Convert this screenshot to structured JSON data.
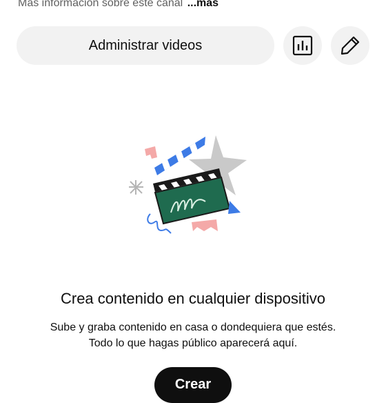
{
  "channel": {
    "more_info_text": "Más información sobre este canal",
    "more_link": "...más"
  },
  "actions": {
    "manage_videos_label": "Administrar videos",
    "analytics_icon": "bar-chart-icon",
    "edit_icon": "pencil-icon"
  },
  "empty_state": {
    "illustration_icon": "clapperboard-illustration",
    "title": "Crea contenido en cualquier dispositivo",
    "description_line1": "Sube y graba contenido en casa o dondequiera que estés.",
    "description_line2": "Todo lo que hagas público aparecerá aquí.",
    "create_button_label": "Crear"
  },
  "colors": {
    "button_bg": "#f2f2f2",
    "text_primary": "#0f0f0f",
    "text_secondary": "#606060",
    "clapper_green": "#1f6b4f",
    "accent_blue": "#3d7be6",
    "accent_pink": "#f4a9a8"
  }
}
